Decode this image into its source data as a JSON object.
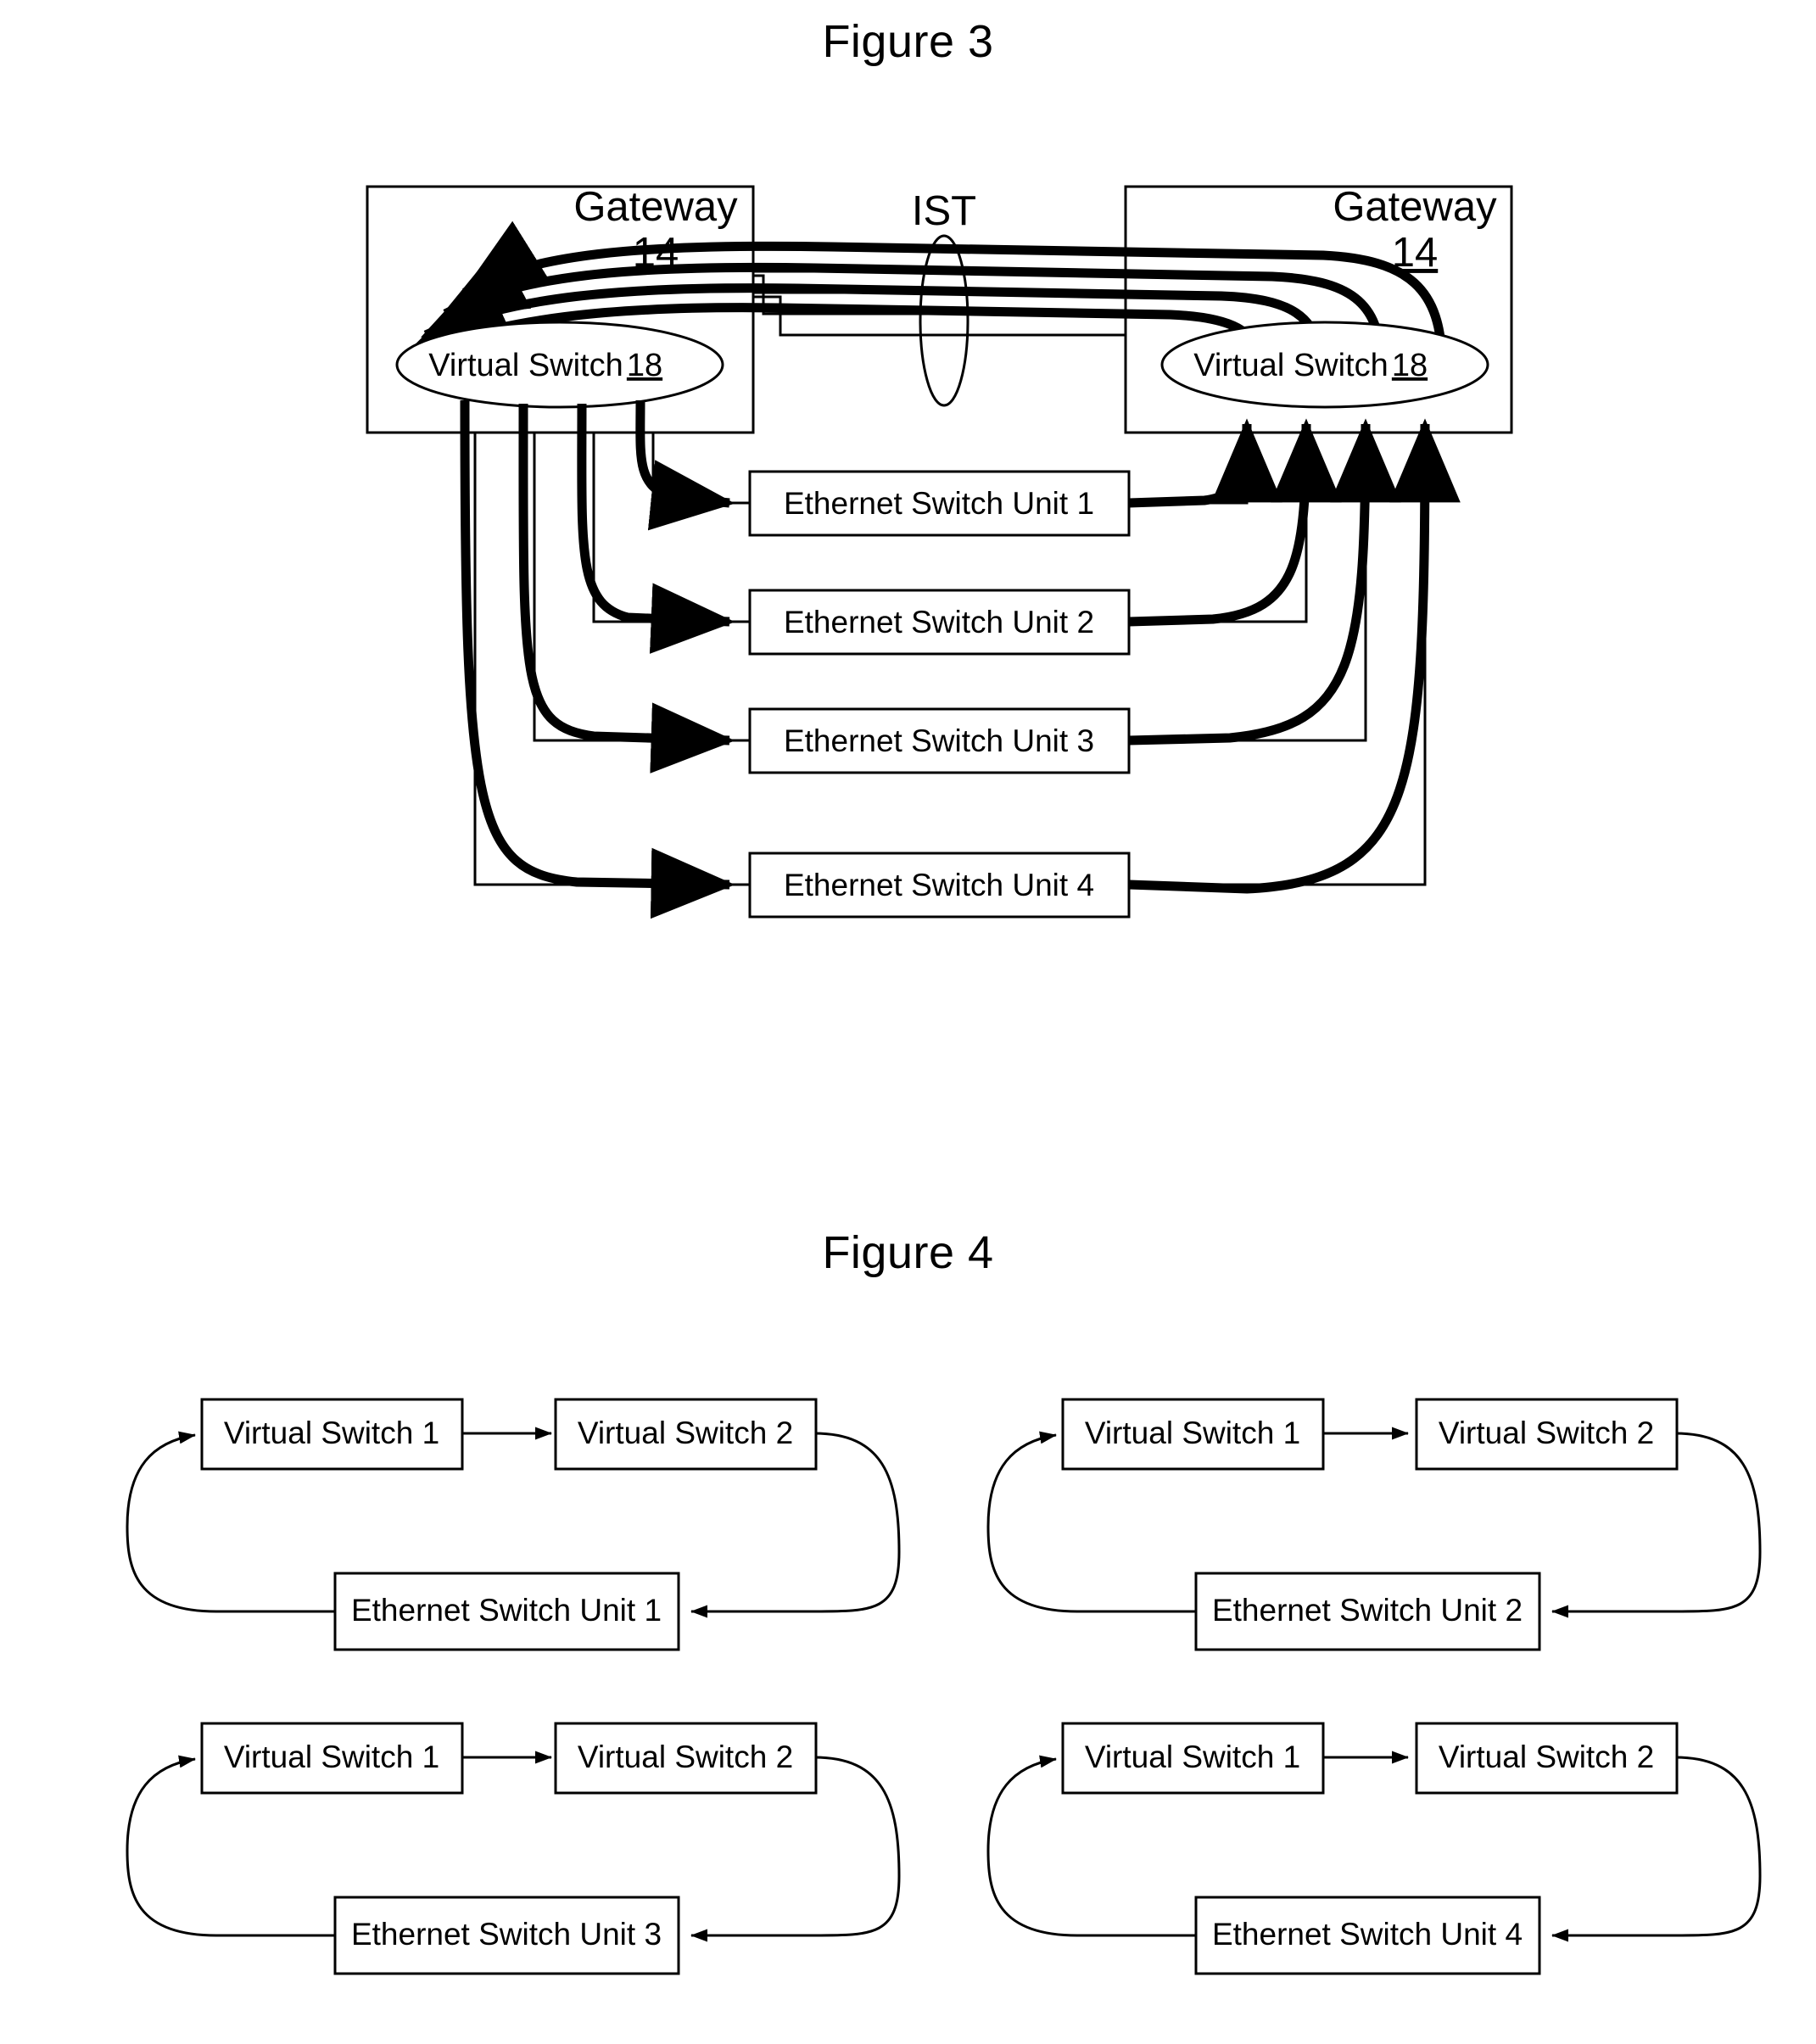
{
  "figure3": {
    "title": "Figure 3",
    "ist_label": "IST",
    "gateway_left": {
      "name": "Gateway",
      "ref": "14"
    },
    "gateway_right": {
      "name": "Gateway",
      "ref": "14"
    },
    "virtual_switch_left": {
      "name": "Virtual Switch",
      "ref": "18"
    },
    "virtual_switch_right": {
      "name": "Virtual Switch",
      "ref": "18"
    },
    "ethernet_units": [
      "Ethernet Switch Unit 1",
      "Ethernet Switch Unit 2",
      "Ethernet Switch Unit 3",
      "Ethernet Switch Unit 4"
    ]
  },
  "figure4": {
    "title": "Figure 4",
    "panels": [
      {
        "virtual_switch_1": "Virtual Switch 1",
        "virtual_switch_2": "Virtual Switch 2",
        "ethernet_unit": "Ethernet Switch Unit 1"
      },
      {
        "virtual_switch_1": "Virtual Switch 1",
        "virtual_switch_2": "Virtual Switch 2",
        "ethernet_unit": "Ethernet Switch Unit 2"
      },
      {
        "virtual_switch_1": "Virtual Switch 1",
        "virtual_switch_2": "Virtual Switch 2",
        "ethernet_unit": "Ethernet Switch Unit 3"
      },
      {
        "virtual_switch_1": "Virtual Switch 1",
        "virtual_switch_2": "Virtual Switch 2",
        "ethernet_unit": "Ethernet Switch Unit 4"
      }
    ]
  },
  "colors": {
    "line": "#000000",
    "background": "#ffffff"
  }
}
